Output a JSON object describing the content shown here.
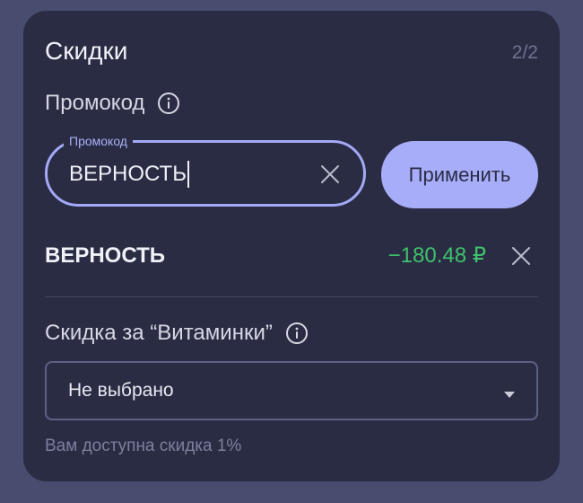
{
  "card": {
    "title": "Скидки",
    "step": "2/2"
  },
  "promo": {
    "section_label": "Промокод",
    "field_label": "Промокод",
    "value": "ВЕРНОСТЬ",
    "apply_label": "Применить"
  },
  "applied": {
    "code": "ВЕРНОСТЬ",
    "amount": "−180.48 ₽"
  },
  "vitaminki": {
    "section_label": "Скидка за “Витаминки”",
    "selected": "Не выбрано",
    "hint": "Вам доступна скидка 1%"
  },
  "icons": {
    "info": "info-icon",
    "clear": "close-icon",
    "dropdown": "caret-down-icon"
  },
  "colors": {
    "accent": "#a7adf8",
    "success": "#3ec26b",
    "card_bg": "#2a2c44",
    "page_bg": "#484d70"
  }
}
